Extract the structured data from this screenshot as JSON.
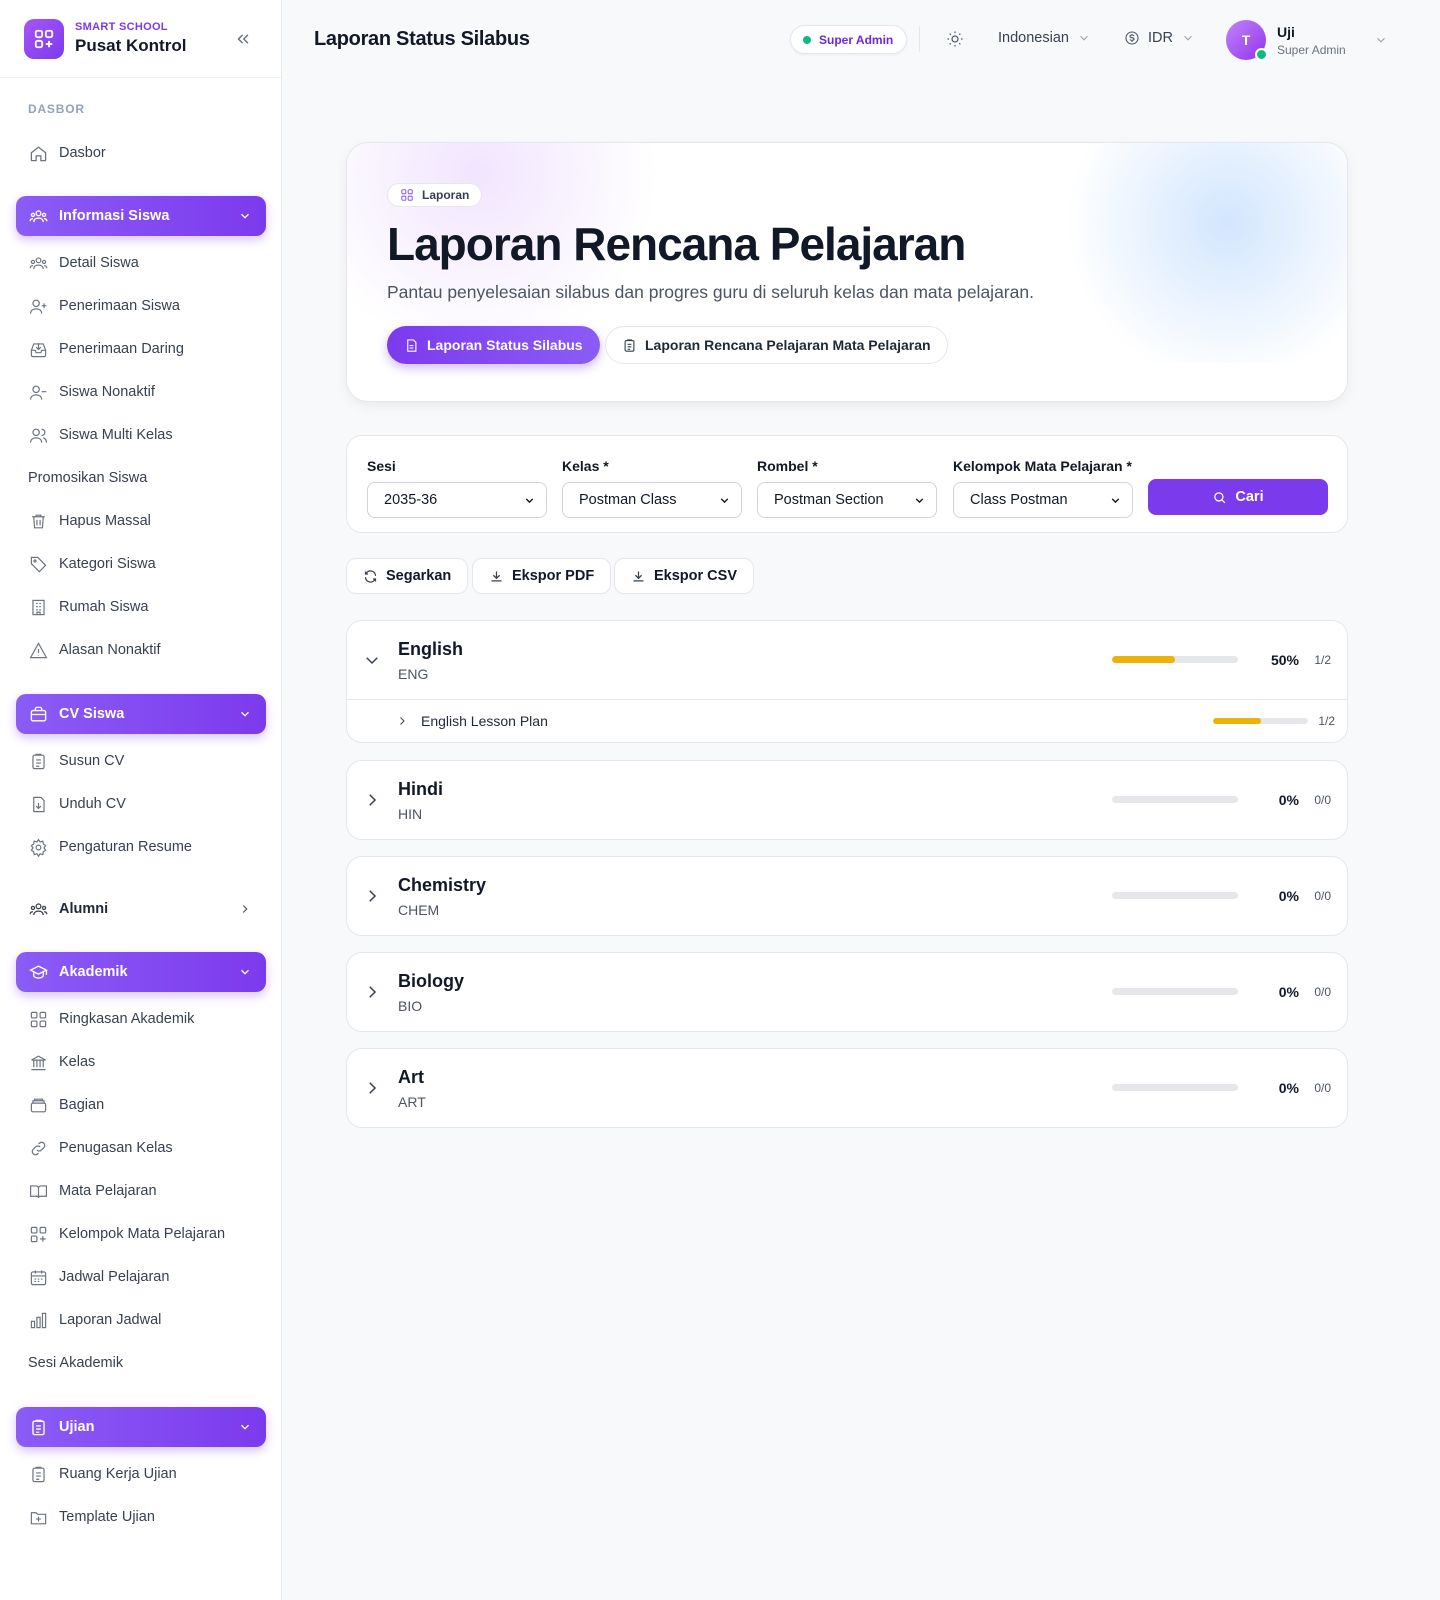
{
  "brand": {
    "small": "SMART SCHOOL",
    "title": "Pusat Kontrol"
  },
  "colors": {
    "accent": "#7c3aed",
    "success": "#10b981",
    "progress": "#eab308"
  },
  "sidebar": {
    "section_dasbor": "DASBOR",
    "dasbor": "Dasbor",
    "group_info_siswa": "Informasi Siswa",
    "info_siswa_items": [
      "Detail Siswa",
      "Penerimaan Siswa",
      "Penerimaan Daring",
      "Siswa Nonaktif",
      "Siswa Multi Kelas",
      "Promosikan Siswa",
      "Hapus Massal",
      "Kategori Siswa",
      "Rumah Siswa",
      "Alasan Nonaktif"
    ],
    "group_cv": "CV Siswa",
    "cv_items": [
      "Susun CV",
      "Unduh CV",
      "Pengaturan Resume"
    ],
    "group_alumni": "Alumni",
    "group_akademik": "Akademik",
    "akademik_items": [
      "Ringkasan Akademik",
      "Kelas",
      "Bagian",
      "Penugasan Kelas",
      "Mata Pelajaran",
      "Kelompok Mata Pelajaran",
      "Jadwal Pelajaran",
      "Laporan Jadwal",
      "Sesi Akademik"
    ],
    "group_ujian": "Ujian",
    "ujian_items": [
      "Ruang Kerja Ujian",
      "Template Ujian"
    ]
  },
  "header": {
    "title": "Laporan Status Silabus",
    "role_badge": "Super Admin",
    "language": "Indonesian",
    "currency": "IDR",
    "user_initial": "T",
    "user_name": "Uji",
    "user_role": "Super Admin"
  },
  "hero": {
    "chip": "Laporan",
    "title": "Laporan Rencana Pelajaran",
    "subtitle": "Pantau penyelesaian silabus dan progres guru di seluruh kelas dan mata pelajaran.",
    "tab_active": "Laporan Status Silabus",
    "tab_other": "Laporan Rencana Pelajaran Mata Pelajaran"
  },
  "filters": {
    "sesi_label": "Sesi",
    "sesi_value": "2035-36",
    "kelas_label": "Kelas *",
    "kelas_value": "Postman Class",
    "rombel_label": "Rombel *",
    "rombel_value": "Postman Section",
    "kelompok_label": "Kelompok Mata Pelajaran *",
    "kelompok_value": "Class Postman",
    "search_label": "Cari"
  },
  "actions": {
    "refresh": "Segarkan",
    "export_pdf": "Ekspor PDF",
    "export_csv": "Ekspor CSV"
  },
  "subjects": [
    {
      "name": "English",
      "code": "ENG",
      "percent": "50%",
      "progress": 0.5,
      "count": "1/2",
      "expanded": true,
      "children": [
        {
          "name": "English Lesson Plan",
          "progress": 0.5,
          "count": "1/2"
        }
      ]
    },
    {
      "name": "Hindi",
      "code": "HIN",
      "percent": "0%",
      "progress": 0,
      "count": "0/0",
      "expanded": false
    },
    {
      "name": "Chemistry",
      "code": "CHEM",
      "percent": "0%",
      "progress": 0,
      "count": "0/0",
      "expanded": false
    },
    {
      "name": "Biology",
      "code": "BIO",
      "percent": "0%",
      "progress": 0,
      "count": "0/0",
      "expanded": false
    },
    {
      "name": "Art",
      "code": "ART",
      "percent": "0%",
      "progress": 0,
      "count": "0/0",
      "expanded": false
    }
  ]
}
